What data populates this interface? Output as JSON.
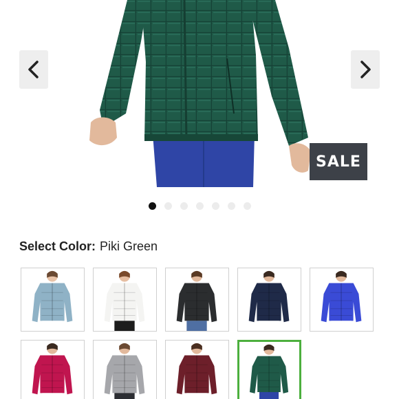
{
  "carousel": {
    "prev_icon": "chevron-left-icon",
    "next_icon": "chevron-right-icon",
    "badge": "SALE",
    "slide_count": 7,
    "active_slide": 1
  },
  "product": {
    "jacket_color": "#1f5a48",
    "pants_color": "#2f45a6"
  },
  "color_select": {
    "label": "Select Color:",
    "selected": "Piki Green",
    "selected_border_color": "#4caf3e",
    "swatches": [
      {
        "jacket": "#8fb2c6",
        "pants": "#ffffff",
        "skin": "#e8c3a8",
        "hair": "#6b4a33"
      },
      {
        "jacket": "#f4f4f2",
        "pants": "#1c1c1c",
        "skin": "#e6bea2",
        "hair": "#7a4a2b"
      },
      {
        "jacket": "#2b2d2f",
        "pants": "#4f6fa3",
        "skin": "#e2b99c",
        "hair": "#5a3a24"
      },
      {
        "jacket": "#1f2a48",
        "pants": "#ffffff",
        "skin": "#e2b99c",
        "hair": "#3a2a20"
      },
      {
        "jacket": "#3a4bd6",
        "pants": "#ffffff",
        "skin": "#e2b99c",
        "hair": "#3a2a20"
      },
      {
        "jacket": "#c0154f",
        "pants": "#ffffff",
        "skin": "#e2b99c",
        "hair": "#3a2a20"
      },
      {
        "jacket": "#a6a7ab",
        "pants": "#2c2e33",
        "skin": "#e2b99c",
        "hair": "#6b4a33"
      },
      {
        "jacket": "#6d1f2a",
        "pants": "#ffffff",
        "skin": "#e2b99c",
        "hair": "#4a2e20"
      },
      {
        "jacket": "#1f5a48",
        "pants": "#2f45a6",
        "skin": "#e2b99c",
        "hair": "#3a2a20",
        "selected": true
      }
    ]
  }
}
